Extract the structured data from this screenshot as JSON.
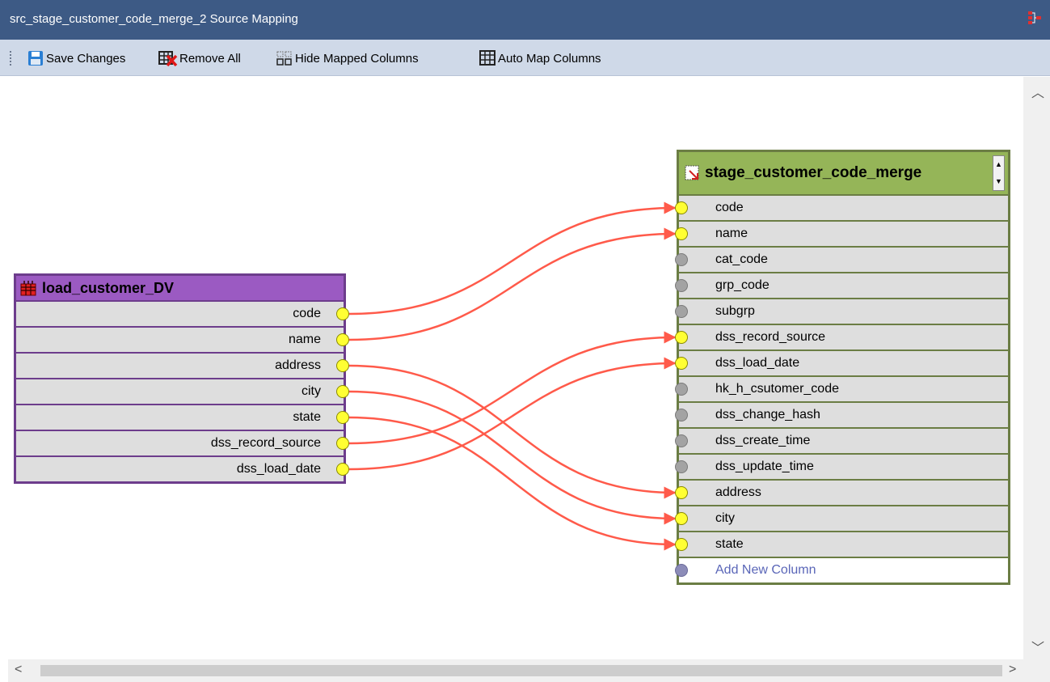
{
  "window": {
    "title": "src_stage_customer_code_merge_2 Source Mapping"
  },
  "toolbar": {
    "save_label": "Save Changes",
    "remove_all_label": "Remove All",
    "hide_mapped_label": "Hide Mapped Columns",
    "auto_map_label": "Auto Map Columns"
  },
  "source_table": {
    "name": "load_customer_DV",
    "icon": "table-icon",
    "color": "#9b5ac2",
    "columns": [
      "code",
      "name",
      "address",
      "city",
      "state",
      "dss_record_source",
      "dss_load_date"
    ]
  },
  "target_table": {
    "name": "stage_customer_code_merge",
    "icon": "stage-table-icon",
    "color": "#95b558",
    "columns": [
      {
        "label": "code",
        "mapped": true
      },
      {
        "label": "name",
        "mapped": true
      },
      {
        "label": "cat_code",
        "mapped": false
      },
      {
        "label": "grp_code",
        "mapped": false
      },
      {
        "label": "subgrp",
        "mapped": false
      },
      {
        "label": "dss_record_source",
        "mapped": true
      },
      {
        "label": "dss_load_date",
        "mapped": true
      },
      {
        "label": "hk_h_csutomer_code",
        "mapped": false
      },
      {
        "label": "dss_change_hash",
        "mapped": false
      },
      {
        "label": "dss_create_time",
        "mapped": false
      },
      {
        "label": "dss_update_time",
        "mapped": false
      },
      {
        "label": "address",
        "mapped": true
      },
      {
        "label": "city",
        "mapped": true
      },
      {
        "label": "state",
        "mapped": true
      }
    ],
    "add_new_label": "Add New Column"
  },
  "mappings": [
    {
      "from": "code",
      "to": "code"
    },
    {
      "from": "name",
      "to": "name"
    },
    {
      "from": "address",
      "to": "address"
    },
    {
      "from": "city",
      "to": "city"
    },
    {
      "from": "state",
      "to": "state"
    },
    {
      "from": "dss_record_source",
      "to": "dss_record_source"
    },
    {
      "from": "dss_load_date",
      "to": "dss_load_date"
    }
  ],
  "colors": {
    "mapping_line": "#ff5a4a",
    "title_bar": "#3d5a85",
    "toolbar": "#cfd9e8"
  }
}
